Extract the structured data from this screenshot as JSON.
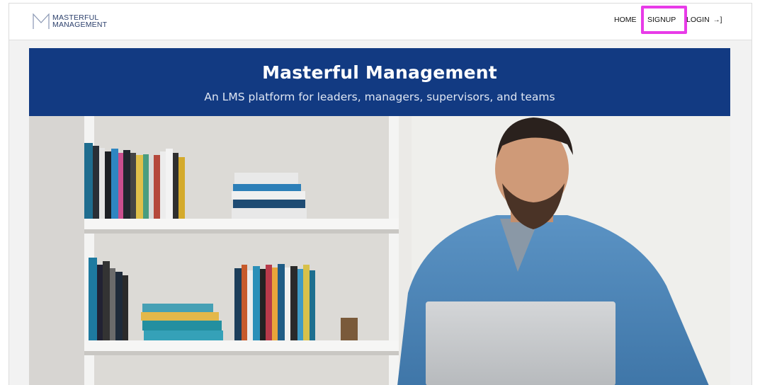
{
  "logo": {
    "line1": "MASTERFUL",
    "line2": "MANAGEMENT"
  },
  "nav": {
    "home": "HOME",
    "signup": "SIGNUP",
    "login": "LOGIN",
    "login_icon": "→]"
  },
  "banner": {
    "title": "Masterful Management",
    "subtitle": "An LMS platform for leaders, managers, supervisors, and teams"
  },
  "colors": {
    "banner": "#123a82",
    "highlight": "#e83be8",
    "logo": "#2b3f6b"
  },
  "icons": {
    "login": "login-arrow-icon",
    "logo": "m-logo-icon"
  },
  "hero_image": "man-with-laptop-in-front-of-bookshelf"
}
